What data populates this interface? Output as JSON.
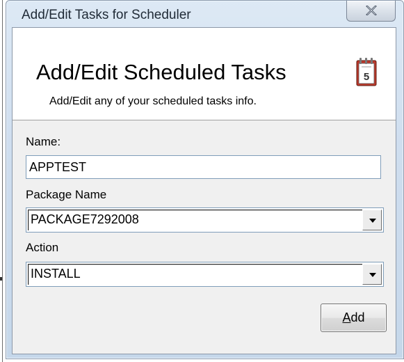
{
  "window": {
    "title": "Add/Edit Tasks for Scheduler",
    "close_icon": "close-x-icon"
  },
  "header": {
    "title": "Add/Edit Scheduled Tasks",
    "subtitle": "Add/Edit any of your scheduled tasks info.",
    "icon": "calendar-icon",
    "icon_text": "5"
  },
  "form": {
    "name_label": "Name:",
    "name_value": "APPTEST",
    "package_label": "Package Name",
    "package_value": "PACKAGE7292008",
    "action_label": "Action",
    "action_value": "INSTALL"
  },
  "buttons": {
    "add_accel": "A",
    "add_rest": "dd"
  },
  "colors": {
    "title_bar_light": "#dde9f5",
    "title_bar_dark": "#c5d7ea",
    "client_background": "#f0f0f0",
    "input_border": "#7f9db9",
    "calendar_red": "#c0392b"
  }
}
